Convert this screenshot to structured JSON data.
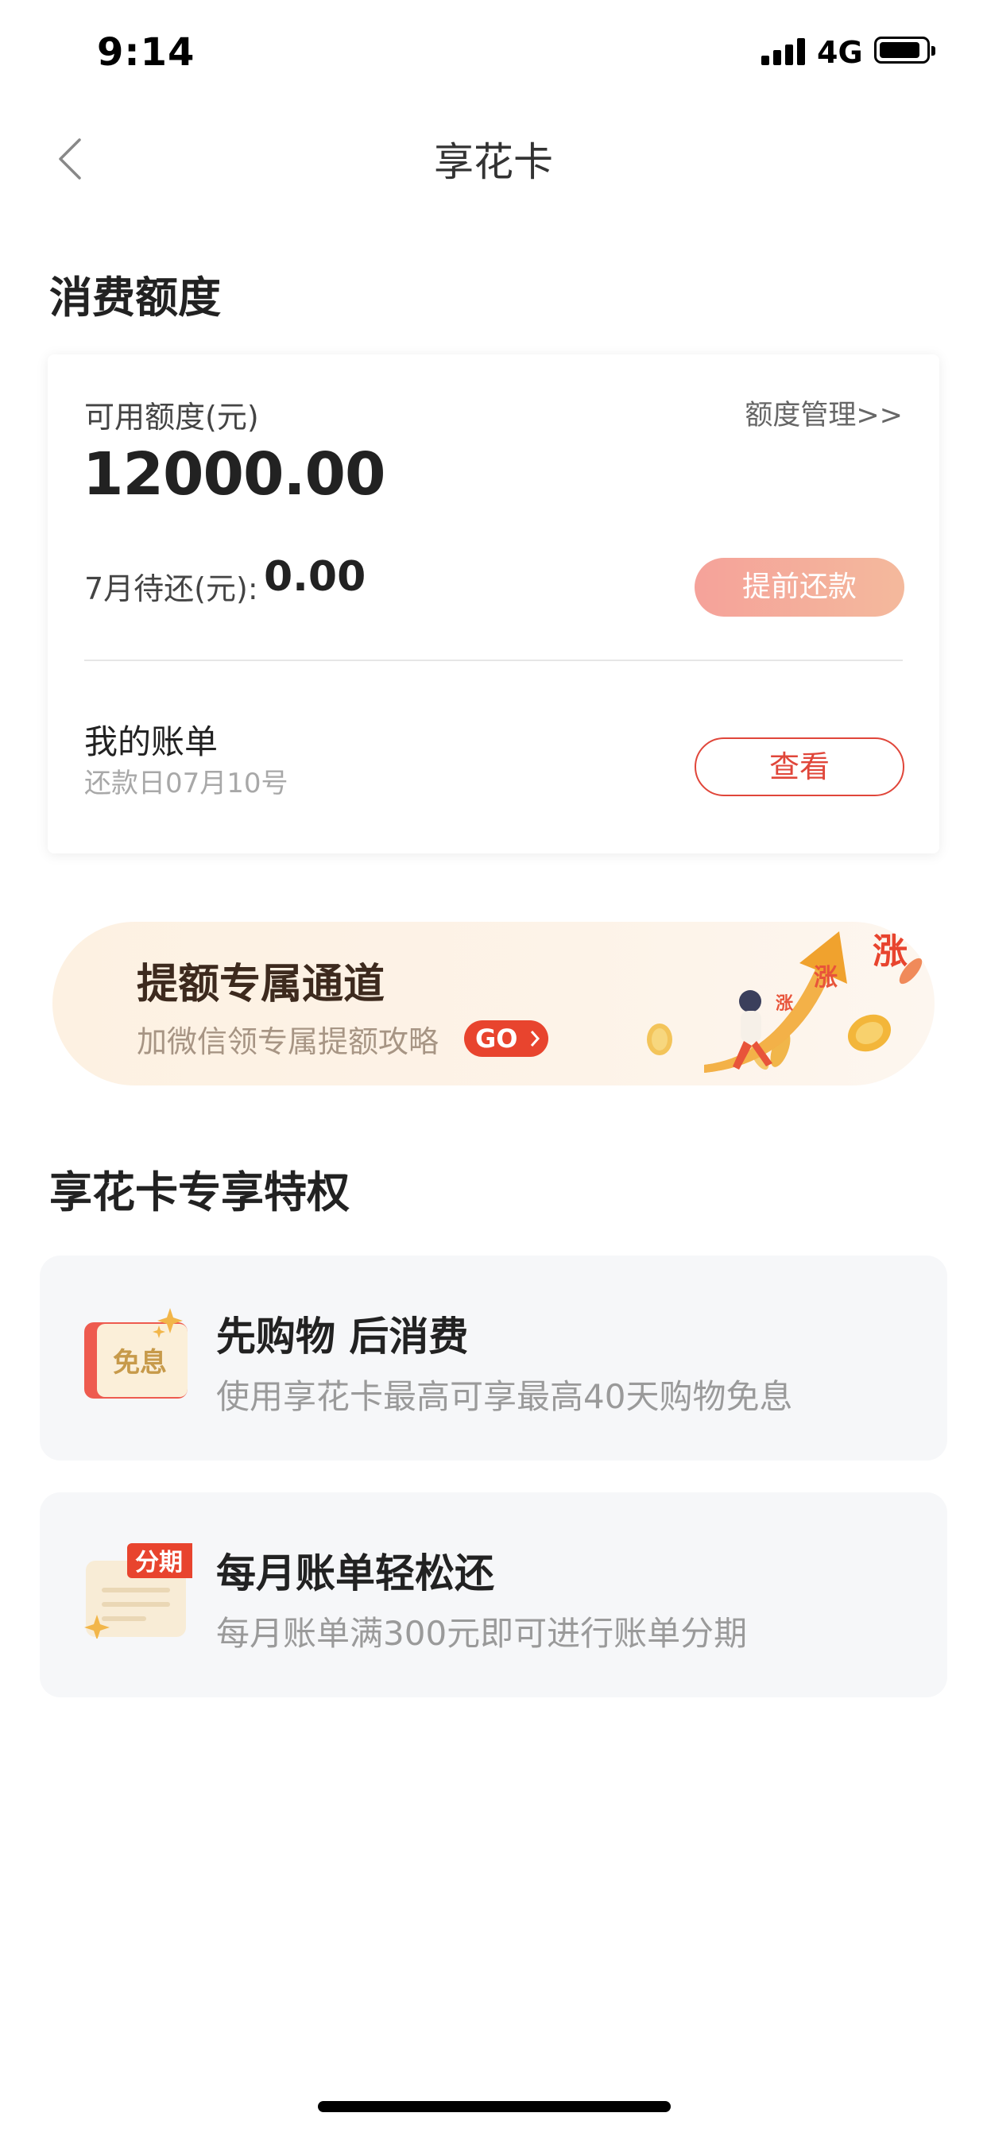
{
  "status_bar": {
    "time": "9:14",
    "network": "4G",
    "icons": [
      "signal-icon",
      "battery-icon"
    ]
  },
  "nav": {
    "title": "享花卡",
    "back_icon": "chevron-left-icon"
  },
  "credit_section": {
    "title": "消费额度",
    "available_label": "可用额度(元)",
    "manage_link": "额度管理>>",
    "available_amount": "12000.00",
    "due_label": "7月待还(元):",
    "due_amount": "0.00",
    "prepay_button": "提前还款",
    "bill_title": "我的账单",
    "bill_date": "还款日07月10号",
    "view_button": "查看"
  },
  "banner": {
    "title": "提额专属通道",
    "subtitle": "加微信领专属提额攻略",
    "go_label": "GO",
    "illustration_text": "涨",
    "colors": {
      "accent": "#e8442e",
      "arrow": "#f0a22e"
    }
  },
  "benefits_section": {
    "title": "享花卡专享特权",
    "items": [
      {
        "icon": "interest-free-icon",
        "icon_label": "免息",
        "title": "先购物 后消费",
        "desc": "使用享花卡最高可享最高40天购物免息"
      },
      {
        "icon": "installment-icon",
        "icon_label": "分期",
        "title": "每月账单轻松还",
        "desc": "每月账单满300元即可进行账单分期"
      }
    ]
  }
}
